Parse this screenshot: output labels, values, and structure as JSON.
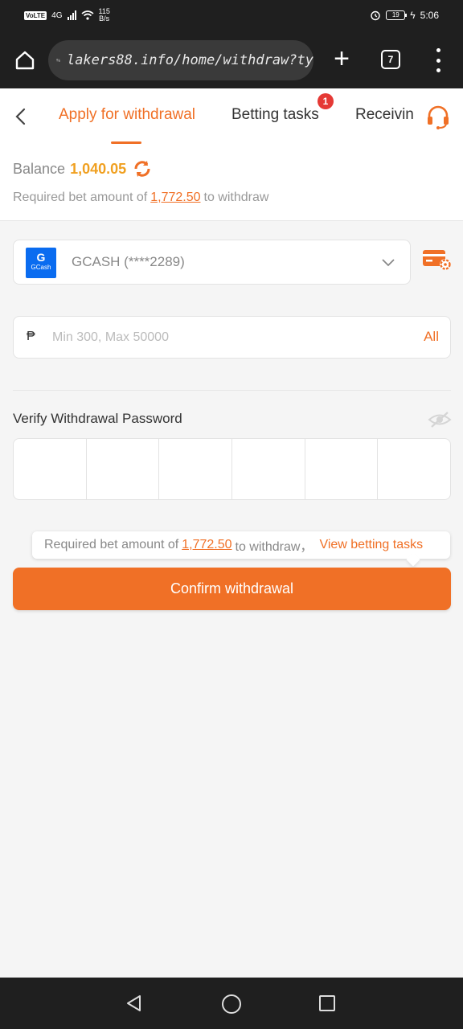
{
  "status_bar": {
    "volte": "VoLTE",
    "network": "4G",
    "speed_value": "115",
    "speed_unit": "B/s",
    "battery": "19",
    "time": "5:06"
  },
  "browser": {
    "url": "lakers88.info/home/withdraw?ty",
    "tabs_count": "7",
    "plus": "+"
  },
  "header": {
    "tabs": [
      {
        "label": "Apply for withdrawal"
      },
      {
        "label": "Betting tasks",
        "badge": "1"
      },
      {
        "label": "Receiving"
      }
    ]
  },
  "balance": {
    "label": "Balance",
    "value": "1,040.05",
    "required_prefix": "Required bet amount of",
    "required_amount": "1,772.50",
    "required_suffix": "to withdraw"
  },
  "account": {
    "logo_letter": "G",
    "logo_text": "GCash",
    "selected": "GCASH (****2289)"
  },
  "amount": {
    "currency": "₱",
    "placeholder": "Min 300, Max 50000",
    "all_label": "All"
  },
  "verify": {
    "label": "Verify Withdrawal Password"
  },
  "tooltip": {
    "prefix": "Required bet amount of",
    "amount": "1,772.50",
    "suffix": "to withdraw，",
    "link": "View betting tasks"
  },
  "confirm": {
    "label": "Confirm withdrawal"
  },
  "colors": {
    "accent": "#f07026",
    "balance": "#f0a020",
    "badge": "#e53935"
  }
}
